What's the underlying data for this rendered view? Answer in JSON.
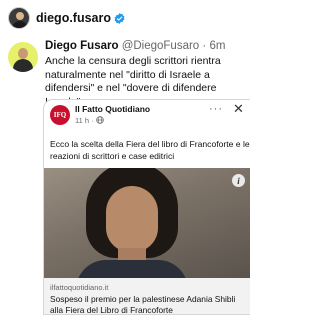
{
  "header": {
    "handle": "diego.fusaro"
  },
  "post": {
    "name": "Diego Fusaro",
    "handle": "@DiegoFusaro",
    "separator": "·",
    "time": "6m",
    "text": "Anche la censura degli scrittori rientra naturalmente nel \"diritto di Israele a difendersi\" e nel \"dovere di difendere Israele\"..."
  },
  "embed": {
    "publisher": "Il Fatto Quotidiano",
    "publisher_logo_text": "IFQ",
    "meta": "11 h · ",
    "text": "Ecco la scelta della Fiera del libro di Francoforte e le reazioni di scrittori e case editrici",
    "domain": "ilfattoquotidiano.it",
    "link_title": "Sospeso il premio per la palestinese Adania Shibli alla Fiera del Libro di Francoforte",
    "more_icon": "more-dots-icon",
    "close_icon": "close-icon",
    "info_icon": "info-icon"
  },
  "colors": {
    "verified": "#1d9bf0",
    "publisher_red": "#c8102e",
    "avatar_yellow": "#e6f06a",
    "footer_bg": "#f2f2f2"
  }
}
